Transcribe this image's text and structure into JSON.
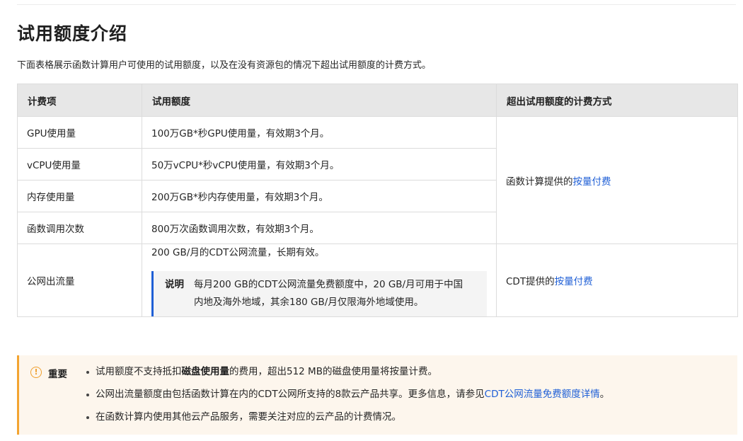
{
  "title": "试用额度介绍",
  "intro": "下面表格展示函数计算用户可使用的试用额度，以及在没有资源包的情况下超出试用额度的计费方式。",
  "table": {
    "headers": [
      "计费项",
      "试用额度",
      "超出试用额度的计费方式"
    ],
    "rows": [
      {
        "item": "GPU使用量",
        "quota": "100万GB*秒GPU使用量，有效期3个月。"
      },
      {
        "item": "vCPU使用量",
        "quota": "50万vCPU*秒vCPU使用量，有效期3个月。"
      },
      {
        "item": "内存使用量",
        "quota": "200万GB*秒内存使用量，有效期3个月。"
      },
      {
        "item": "函数调用次数",
        "quota": "800万次函数调用次数，有效期3个月。"
      }
    ],
    "fc_billing": {
      "prefix": "函数计算提供的",
      "link": "按量付费"
    },
    "cdt_row": {
      "item": "公网出流量",
      "quota": "200 GB/月的CDT公网流量，长期有效。",
      "note_label": "说明",
      "note_text": "每月200 GB的CDT公网流量免费额度中，20 GB/月可用于中国内地及海外地域，其余180 GB/月仅限海外地域使用。",
      "billing_prefix": "CDT提供的",
      "billing_link": "按量付费"
    }
  },
  "important": {
    "icon": "exclamation-circle-icon",
    "label": "重要",
    "item1_before": "试用额度不支持抵扣",
    "item1_bold": "磁盘使用量",
    "item1_after": "的费用，超出512 MB的磁盘使用量将按量计费。",
    "item2_before": "公网出流量额度由包括函数计算在内的CDT公网所支持的8款云产品共享。更多信息，请参见",
    "item2_link": "CDT公网流量免费额度详情",
    "item2_after": "。",
    "item3": "在函数计算内使用其他云产品服务，需要关注对应的云产品的计费情况。"
  },
  "colors": {
    "link": "#1f5fd6",
    "note_border": "#1f5fd6",
    "important_border": "#f3a431",
    "important_bg": "#fdf6ed"
  }
}
